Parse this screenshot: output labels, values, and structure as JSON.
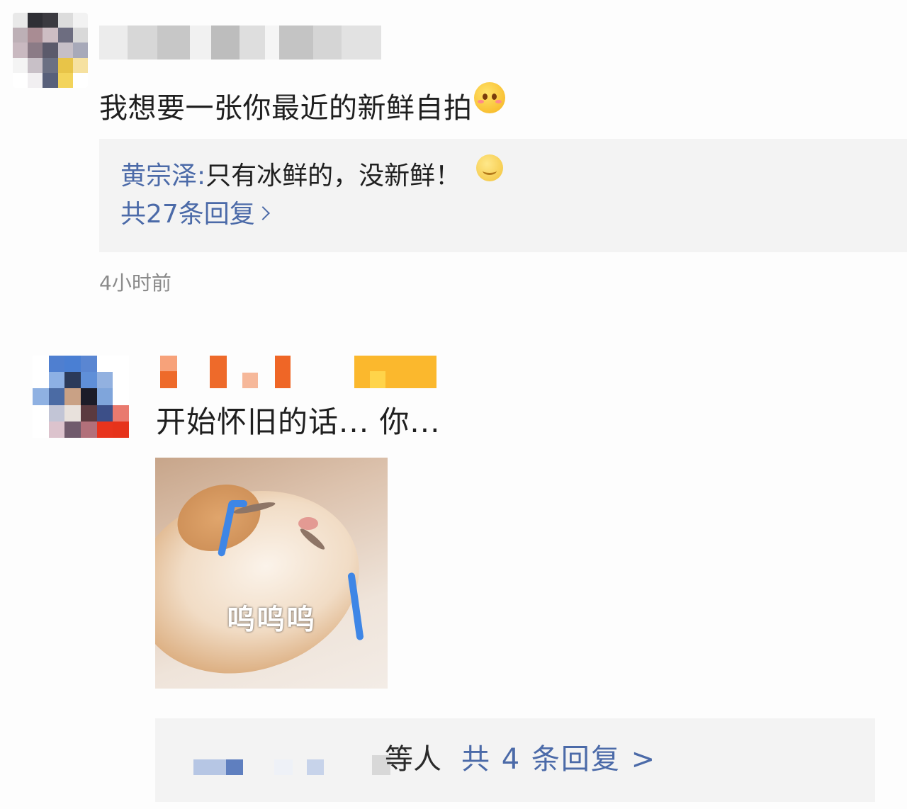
{
  "comments": [
    {
      "text": "我想要一张你最近的新鲜自拍",
      "text_emoji": "shy-face-emoji",
      "reply_preview": {
        "author": "黄宗泽",
        "separator": ":",
        "content": "只有冰鲜的，没新鲜！",
        "content_emoji": "sleepy-face-emoji"
      },
      "reply_count_label": "共27条回复",
      "timestamp": "4小时前"
    },
    {
      "text": "开始怀旧的话... 你...",
      "sticker_caption": "呜呜呜",
      "reply_summary": {
        "suffix": "等人",
        "link": "共 4 条回复 >"
      }
    }
  ],
  "colors": {
    "link": "#4b6aa8",
    "reply_bg": "#f3f3f3",
    "timestamp": "#8a8a8a",
    "tear": "#3e86e6"
  }
}
